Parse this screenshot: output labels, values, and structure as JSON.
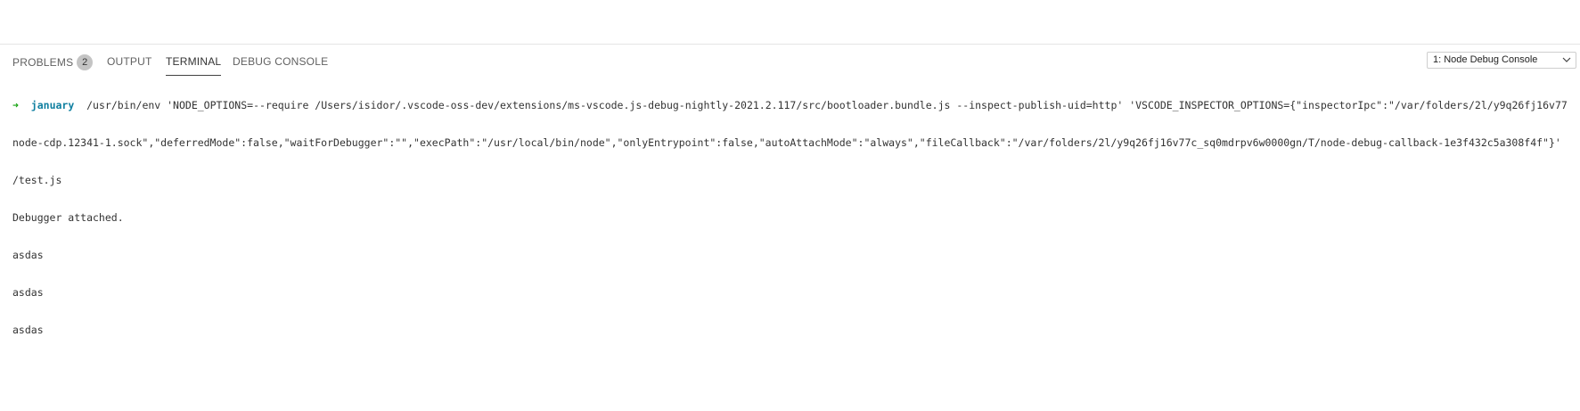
{
  "tabs": {
    "problems": "PROBLEMS",
    "problems_count": "2",
    "output": "OUTPUT",
    "terminal": "TERMINAL",
    "debug_console": "DEBUG CONSOLE"
  },
  "terminal_select": {
    "selected": "1: Node Debug Console"
  },
  "terminal": {
    "prompt_arrow": "➜",
    "prompt_dir": "january",
    "command_line1": " /usr/bin/env 'NODE_OPTIONS=--require /Users/isidor/.vscode-oss-dev/extensions/ms-vscode.js-debug-nightly-2021.2.117/src/bootloader.bundle.js --inspect-publish-uid=http' 'VSCODE_INSPECTOR_OPTIONS={\"inspectorIpc\":\"/var/folders/2l/y9q26fj16v77",
    "command_line2": "node-cdp.12341-1.sock\",\"deferredMode\":false,\"waitForDebugger\":\"\",\"execPath\":\"/usr/local/bin/node\",\"onlyEntrypoint\":false,\"autoAttachMode\":\"always\",\"fileCallback\":\"/var/folders/2l/y9q26fj16v77c_sq0mdrpv6w0000gn/T/node-debug-callback-1e3f432c5a308f4f\"}'",
    "command_line3": "/test.js",
    "output_lines": [
      "Debugger attached.",
      "asdas",
      "asdas",
      "asdas"
    ]
  }
}
